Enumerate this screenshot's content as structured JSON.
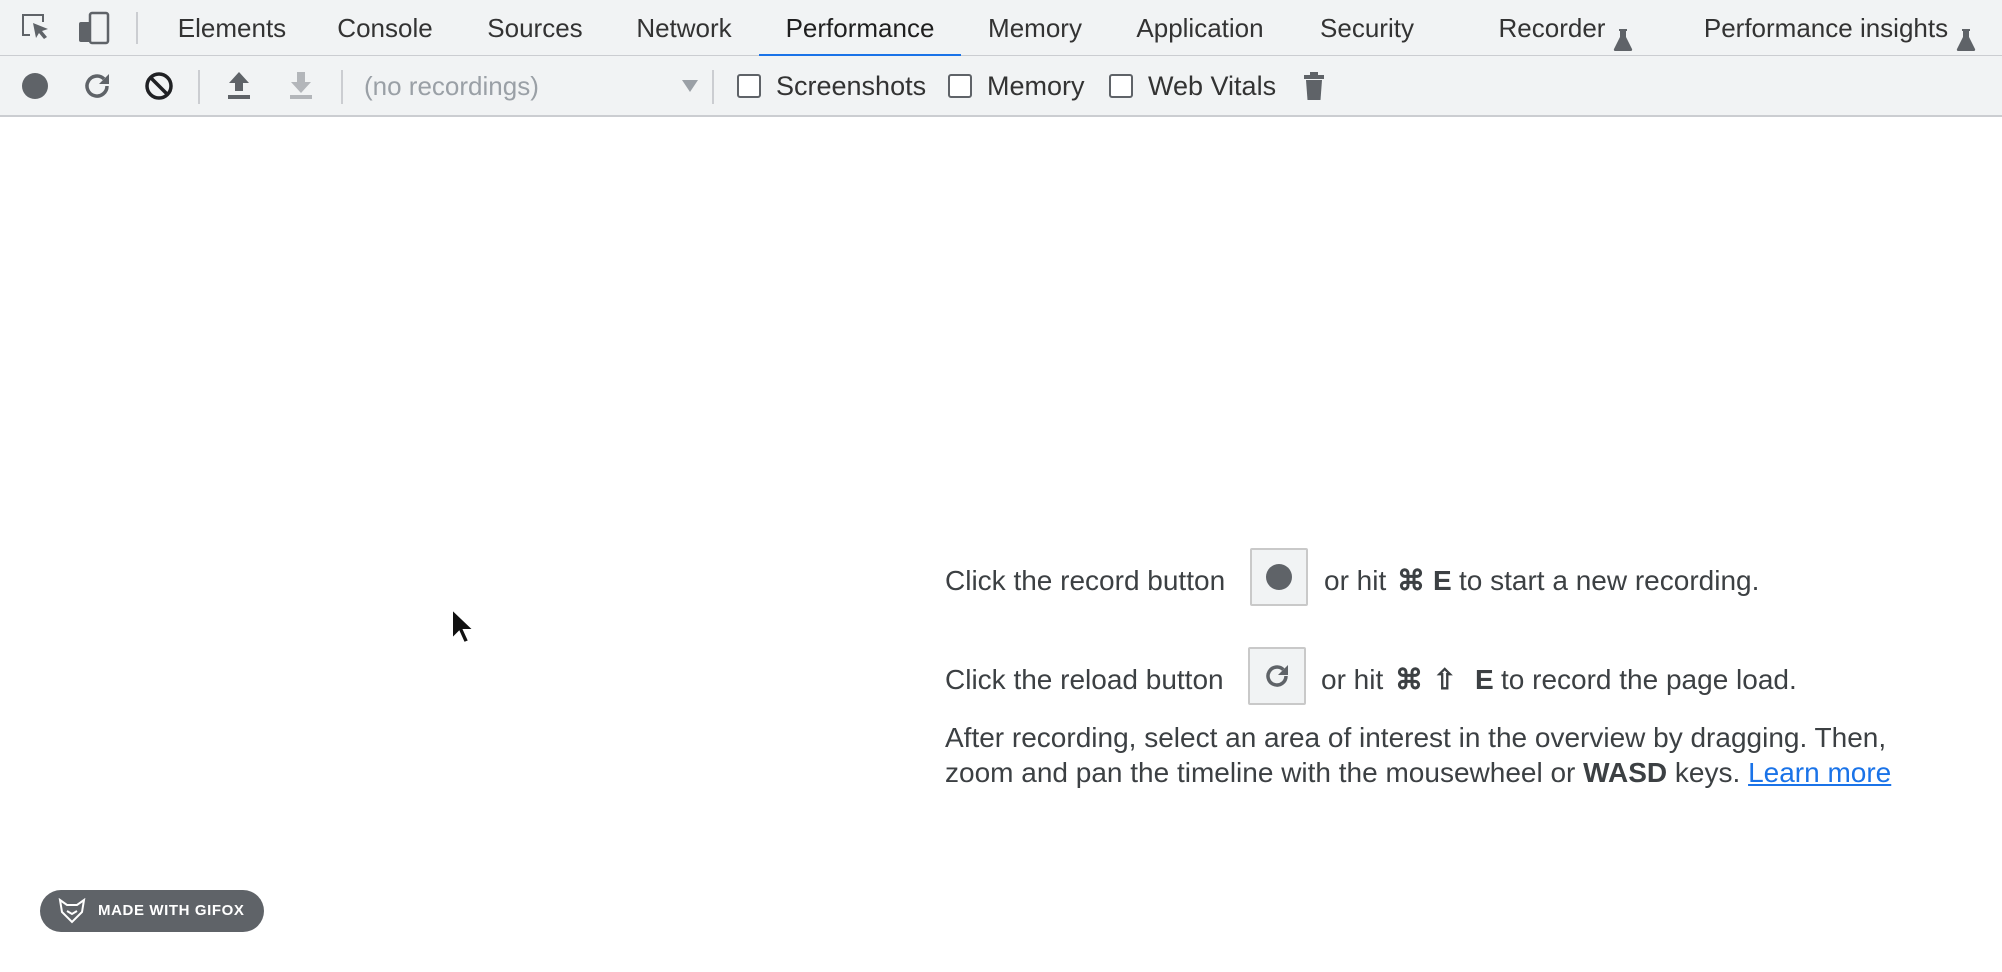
{
  "tabs": [
    {
      "label": "Elements",
      "active": false
    },
    {
      "label": "Console",
      "active": false
    },
    {
      "label": "Sources",
      "active": false
    },
    {
      "label": "Network",
      "active": false
    },
    {
      "label": "Performance",
      "active": true
    },
    {
      "label": "Memory",
      "active": false
    },
    {
      "label": "Application",
      "active": false
    },
    {
      "label": "Security",
      "active": false
    },
    {
      "label": "Recorder",
      "active": false,
      "icon": "flask-icon"
    },
    {
      "label": "Performance insights",
      "active": false,
      "icon": "flask-icon"
    }
  ],
  "toolbar": {
    "recordings_select": {
      "value": "(no recordings)"
    },
    "checkboxes": [
      {
        "label": "Screenshots",
        "checked": false
      },
      {
        "label": "Memory",
        "checked": false
      },
      {
        "label": "Web Vitals",
        "checked": false
      }
    ]
  },
  "landing": {
    "record": {
      "prefix": "Click the record button",
      "hint": "or hit",
      "key_cmd": "⌘",
      "key": "E",
      "suffix": "to start a new recording."
    },
    "reload": {
      "prefix": "Click the reload button",
      "hint": "or hit",
      "key_cmd": "⌘",
      "key_shift": "⇧",
      "key": "E",
      "suffix": "to record the page load."
    },
    "info": {
      "text_part1": "After recording, select an area of interest in the overview by dragging. Then, zoom and pan the timeline with the mousewheel or",
      "bold": "WASD",
      "text_part2": "keys.",
      "link": "Learn more"
    }
  },
  "badge": {
    "label": "MADE WITH GIFOX"
  },
  "colors": {
    "accent": "#1a73e8",
    "toolbar_bg": "#f1f3f4",
    "icon": "#5f6368"
  }
}
